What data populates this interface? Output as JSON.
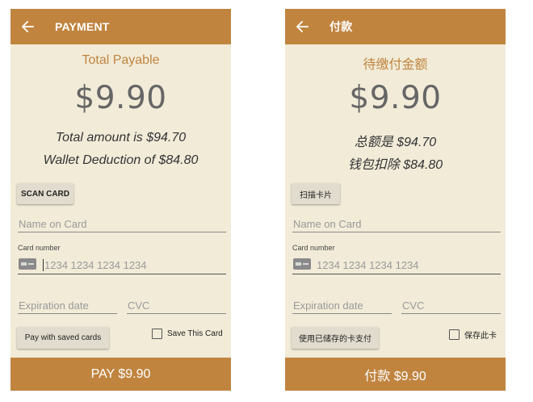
{
  "colors": {
    "accent": "#c0843f",
    "background": "#f1ebd8",
    "button": "#e1dcce"
  },
  "screens": [
    {
      "back_icon": "arrow-left-icon",
      "title": "PAYMENT",
      "total_payable_label": "Total Payable",
      "amount": "$9.90",
      "total_amount_text": "Total amount is $94.70",
      "wallet_deduction_text": "Wallet Deduction of $84.80",
      "scan_card_label": "SCAN CARD",
      "name_on_card_placeholder": "Name on Card",
      "card_number_label": "Card number",
      "card_icon": "credit-card-icon",
      "card_number_placeholder": "1234 1234 1234 1234",
      "expiration_placeholder": "Expiration date",
      "cvc_placeholder": "CVC",
      "saved_cards_label": "Pay with saved cards",
      "save_card_label": "Save This Card",
      "save_card_checked": false,
      "pay_label": "PAY $9.90"
    },
    {
      "back_icon": "arrow-left-icon",
      "title": "付款",
      "total_payable_label": "待缴付金额",
      "amount": "$9.90",
      "total_amount_text": "总额是 $94.70",
      "wallet_deduction_text": "钱包扣除 $84.80",
      "scan_card_label": "扫描卡片",
      "name_on_card_placeholder": "Name on Card",
      "card_number_label": "Card number",
      "card_icon": "credit-card-icon",
      "card_number_placeholder": "1234 1234 1234 1234",
      "expiration_placeholder": "Expiration date",
      "cvc_placeholder": "CVC",
      "saved_cards_label": "使用已储存的卡支付",
      "save_card_label": "保存此卡",
      "save_card_checked": false,
      "pay_label": "付款 $9.90"
    }
  ]
}
